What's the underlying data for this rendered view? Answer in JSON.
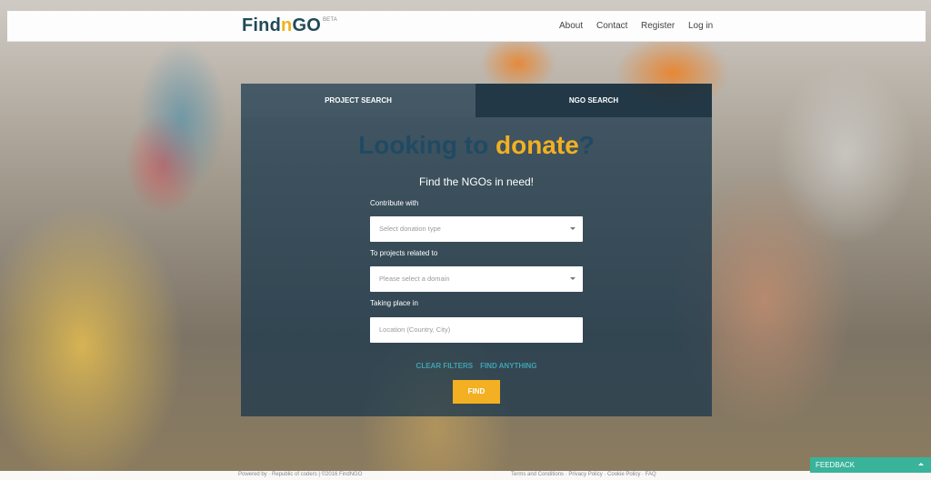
{
  "header": {
    "logo_main": "Find",
    "logo_n": "n",
    "logo_end": "GO",
    "logo_beta": "BETA",
    "nav": {
      "about": "About",
      "contact": "Contact",
      "register": "Register",
      "login": "Log in"
    }
  },
  "tabs": {
    "project": "PROJECT SEARCH",
    "ngo": "NGO SEARCH"
  },
  "hero": {
    "headline_pre": "Looking to ",
    "headline_hl": "donate",
    "headline_post": "?",
    "subtitle": "Find the NGOs in need!"
  },
  "form": {
    "contribute_label": "Contribute with",
    "donation_placeholder": "Select donation type",
    "projects_label": "To projects related to",
    "domain_placeholder": "Please select a domain",
    "location_label": "Taking place in",
    "location_placeholder": "Location (Country, City)"
  },
  "actions": {
    "clear": "CLEAR FILTERS",
    "find_anything": "FIND ANYTHING",
    "find": "FIND"
  },
  "footer": {
    "left": "Powered by · Republic of coders | ©2016 FindNGO",
    "right": "Terms and Conditions · Privacy Policy · Cookie Policy · FAQ"
  },
  "feedback": "FEEDBACK",
  "colors": {
    "accent_yellow": "#f2b022",
    "brand_dark": "#214a57",
    "teal": "#3fa3b1",
    "feedback_green": "#39b39a"
  }
}
